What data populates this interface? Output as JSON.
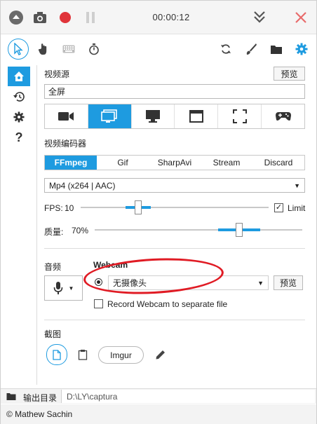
{
  "topbar": {
    "timer": "00:00:12",
    "icons": [
      "collapse-icon",
      "camera-icon",
      "record-icon",
      "pause-icon",
      "minimize-icon",
      "close-icon"
    ]
  },
  "toolbar": {
    "icons": [
      "cursor-icon",
      "hand-icon",
      "keyboard-icon",
      "stopwatch-icon",
      "refresh-icon",
      "brush-icon",
      "folder-icon",
      "settings-icon"
    ]
  },
  "nav": {
    "icons": [
      "home-icon",
      "history-icon",
      "gear-icon",
      "help-icon"
    ]
  },
  "video_source": {
    "label": "视频源",
    "preview_label": "预览",
    "value": "全屏",
    "sources": [
      "webcam",
      "screen",
      "monitor",
      "window",
      "region",
      "game"
    ],
    "active_source": "screen"
  },
  "encoder": {
    "label": "视频编码器",
    "tabs": [
      "FFmpeg",
      "Gif",
      "SharpAvi",
      "Stream",
      "Discard"
    ],
    "active_tab": "FFmpeg",
    "format": "Mp4 (x264 | AAC)"
  },
  "fps": {
    "label": "FPS:",
    "value": "10",
    "limit_label": "Limit",
    "limit_checked": "✓"
  },
  "quality": {
    "label": "质量:",
    "value": "70%"
  },
  "audio": {
    "label": "音频"
  },
  "webcam": {
    "label": "Webcam",
    "value": "无摄像头",
    "preview_label": "预览",
    "separate_label": "Record Webcam to separate file"
  },
  "screenshot": {
    "label": "截图",
    "imgur_label": "Imgur"
  },
  "output": {
    "label": "输出目录",
    "path": "D:\\LY\\captura"
  },
  "footer": {
    "text": "© Mathew Sachin"
  },
  "colors": {
    "accent": "#1e9be0",
    "record": "#e0343a",
    "close": "#e86b6b",
    "annotation": "#e01b24"
  }
}
